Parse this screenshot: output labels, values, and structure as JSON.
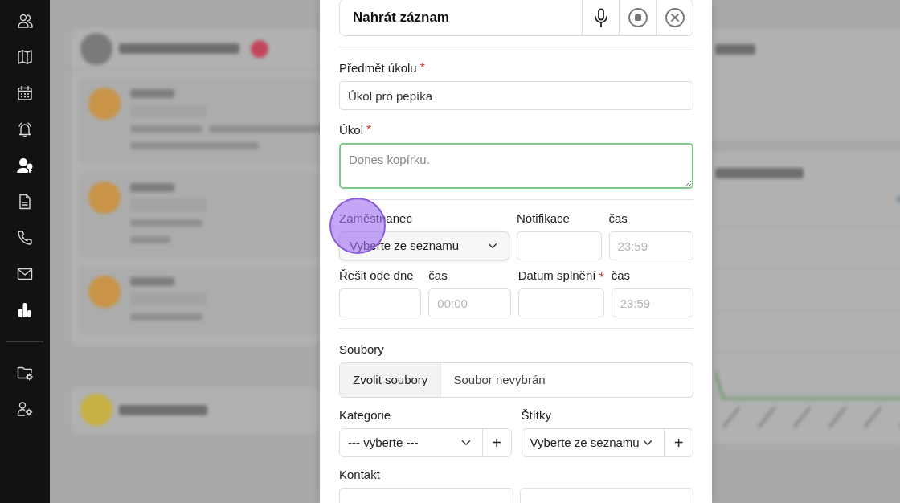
{
  "sidebar": {
    "items": [
      {
        "kind": "users",
        "emphasized": false
      },
      {
        "kind": "map",
        "emphasized": false
      },
      {
        "kind": "calendar",
        "emphasized": false
      },
      {
        "kind": "alarm",
        "emphasized": false
      },
      {
        "kind": "user-key",
        "emphasized": true
      },
      {
        "kind": "document",
        "emphasized": false
      },
      {
        "kind": "phone",
        "emphasized": false
      },
      {
        "kind": "mail",
        "emphasized": false
      },
      {
        "kind": "chart",
        "emphasized": true
      }
    ],
    "bottom_items": [
      {
        "kind": "folder-gear",
        "emphasized": false
      },
      {
        "kind": "user-gear",
        "emphasized": false
      }
    ]
  },
  "modal": {
    "required_mark": "*",
    "recorder": {
      "title": "Nahrát záznam",
      "buttons": [
        {
          "kind": "mic"
        },
        {
          "kind": "stop"
        },
        {
          "kind": "close"
        }
      ]
    },
    "subject": {
      "label": "Předmět úkolu",
      "required": true,
      "value": "Úkol pro pepíka"
    },
    "task": {
      "label": "Úkol",
      "required": true,
      "placeholder": "Dones kopírku.",
      "valid": true
    },
    "row_1": [
      {
        "kind": "select",
        "label": "Zaměstnanec",
        "value": "Vyberte ze seznamu",
        "clicked": true
      },
      {
        "kind": "input",
        "label": "Notifikace"
      },
      {
        "kind": "input",
        "label": "čas",
        "placeholder": "23:59"
      }
    ],
    "row_2": [
      {
        "kind": "input",
        "label": "Řešit ode dne"
      },
      {
        "kind": "input",
        "label": "čas",
        "placeholder": "00:00"
      },
      {
        "kind": "input",
        "label": "Datum splnění",
        "required": true
      },
      {
        "kind": "input",
        "label": "čas",
        "placeholder": "23:59"
      }
    ],
    "files": {
      "label": "Soubory",
      "button": "Zvolit soubory",
      "status": "Soubor nevybrán"
    },
    "row_3": [
      {
        "label": "Kategorie",
        "value": "--- vyberte ---",
        "add": "+"
      },
      {
        "label": "Štítky",
        "value": "Vyberte ze seznamu",
        "add": "+"
      }
    ],
    "contact": {
      "label": "Kontakt"
    }
  }
}
